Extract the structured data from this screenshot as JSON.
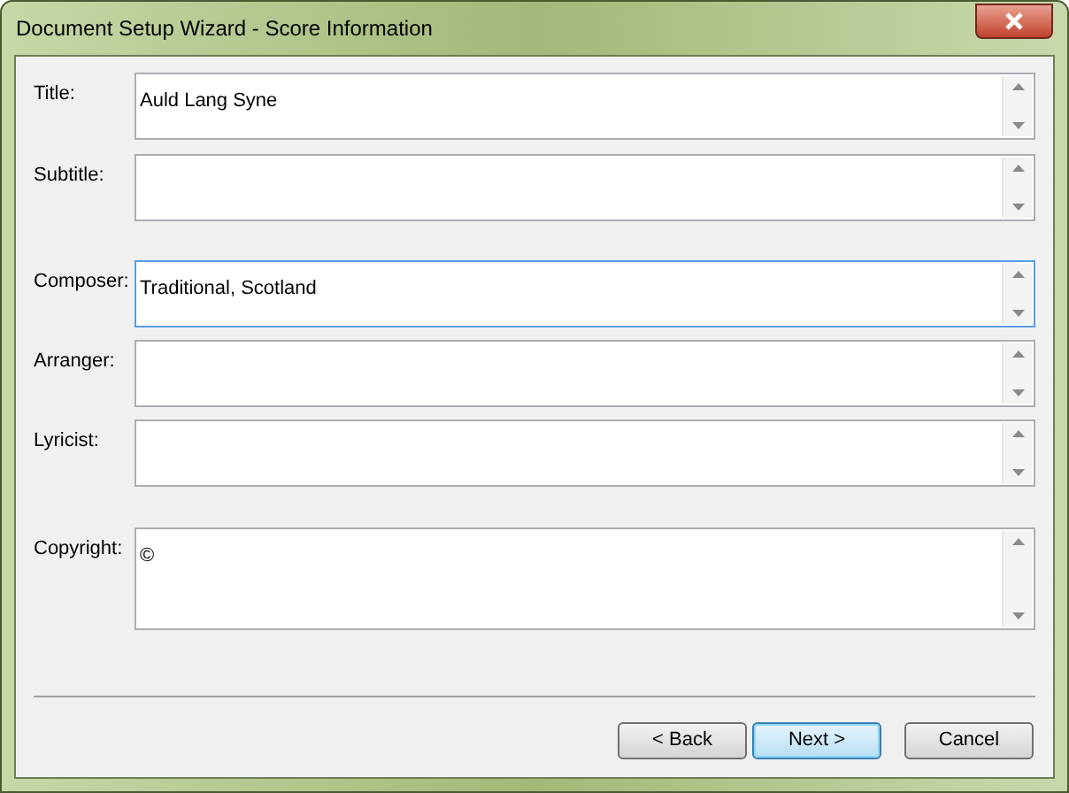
{
  "window": {
    "title": "Document Setup Wizard - Score Information"
  },
  "field_groups": [
    [
      {
        "label": "Title:",
        "value": "Auld Lang Syne",
        "focused": false
      },
      {
        "label": "Subtitle:",
        "focused": false
      }
    ],
    [
      {
        "label": "Composer:",
        "value": "Traditional, Scotland",
        "focused": true
      },
      {
        "label": "Arranger:",
        "focused": false
      },
      {
        "label": "Lyricist:",
        "focused": false
      }
    ],
    [
      {
        "label": "Copyright:",
        "value": "©",
        "focused": false
      }
    ]
  ],
  "buttons": [
    {
      "label": "< Back",
      "default": false
    },
    {
      "label": "Next >",
      "default": true
    },
    {
      "label": "Cancel",
      "default": false
    }
  ]
}
